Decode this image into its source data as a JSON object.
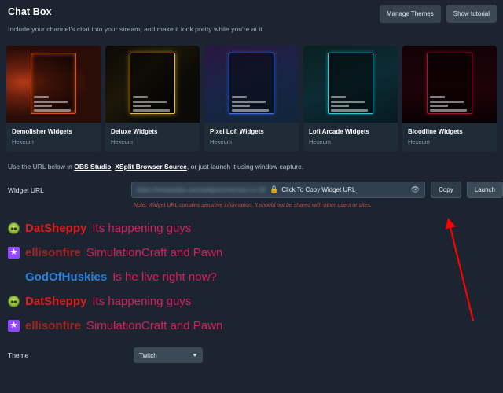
{
  "header": {
    "title": "Chat Box",
    "subtitle": "Include your channel's chat into your stream, and make it look pretty while you're at it.",
    "manage_themes_label": "Manage Themes",
    "show_tutorial_label": "Show tutorial"
  },
  "themes": [
    {
      "name": "Demolisher Widgets",
      "author": "Hexeum",
      "art": "t-demolisher"
    },
    {
      "name": "Deluxe Widgets",
      "author": "Hexeum",
      "art": "t-deluxe"
    },
    {
      "name": "Pixel Lofi Widgets",
      "author": "Hexeum",
      "art": "t-pixel"
    },
    {
      "name": "Lofi Arcade Widgets",
      "author": "Hexeum",
      "art": "t-lofi"
    },
    {
      "name": "Bloodline Widgets",
      "author": "Hexeum",
      "art": "t-bloodline"
    }
  ],
  "url_section": {
    "hint_prefix": "Use the URL below in ",
    "link_obs": "OBS Studio",
    "hint_comma": ", ",
    "link_xsplit": "XSplit Browser Source",
    "hint_suffix": ", or just launch it using window capture.",
    "field_label": "Widget URL",
    "url_value": "https://streamlabs.com/widgets/chat-box-v1-09",
    "lock_icon": "lock-icon",
    "copy_hint": "Click To Copy Widget URL",
    "eye_icon": "eye-icon",
    "copy_label": "Copy",
    "launch_label": "Launch",
    "note": "Note: Widget URL contains sensitive information. It should not be shared with other users or sites."
  },
  "chat_preview": [
    {
      "badge": "face",
      "user": "DatSheppy",
      "user_color": "#e01b1b",
      "text": "Its happening guys",
      "text_color": "#d81f5a"
    },
    {
      "badge": "star",
      "user": "ellisonfire",
      "user_color": "#a52222",
      "text": "SimulationCraft and Pawn",
      "text_color": "#d81f5a"
    },
    {
      "badge": "none",
      "user": "GodOfHuskies",
      "user_color": "#2a7fe0",
      "text": "Is he live right now?",
      "text_color": "#d81f5a"
    },
    {
      "badge": "face",
      "user": "DatSheppy",
      "user_color": "#e01b1b",
      "text": "Its happening guys",
      "text_color": "#d81f5a"
    },
    {
      "badge": "star",
      "user": "ellisonfire",
      "user_color": "#a52222",
      "text": "SimulationCraft and Pawn",
      "text_color": "#d81f5a"
    }
  ],
  "theme_select": {
    "label": "Theme",
    "value": "Twitch"
  },
  "annotation": {
    "arrow_color": "#ff0000"
  },
  "colors": {
    "page_bg": "#1b2430",
    "card_bg": "#202b38",
    "accent_note": "#c0564e"
  }
}
